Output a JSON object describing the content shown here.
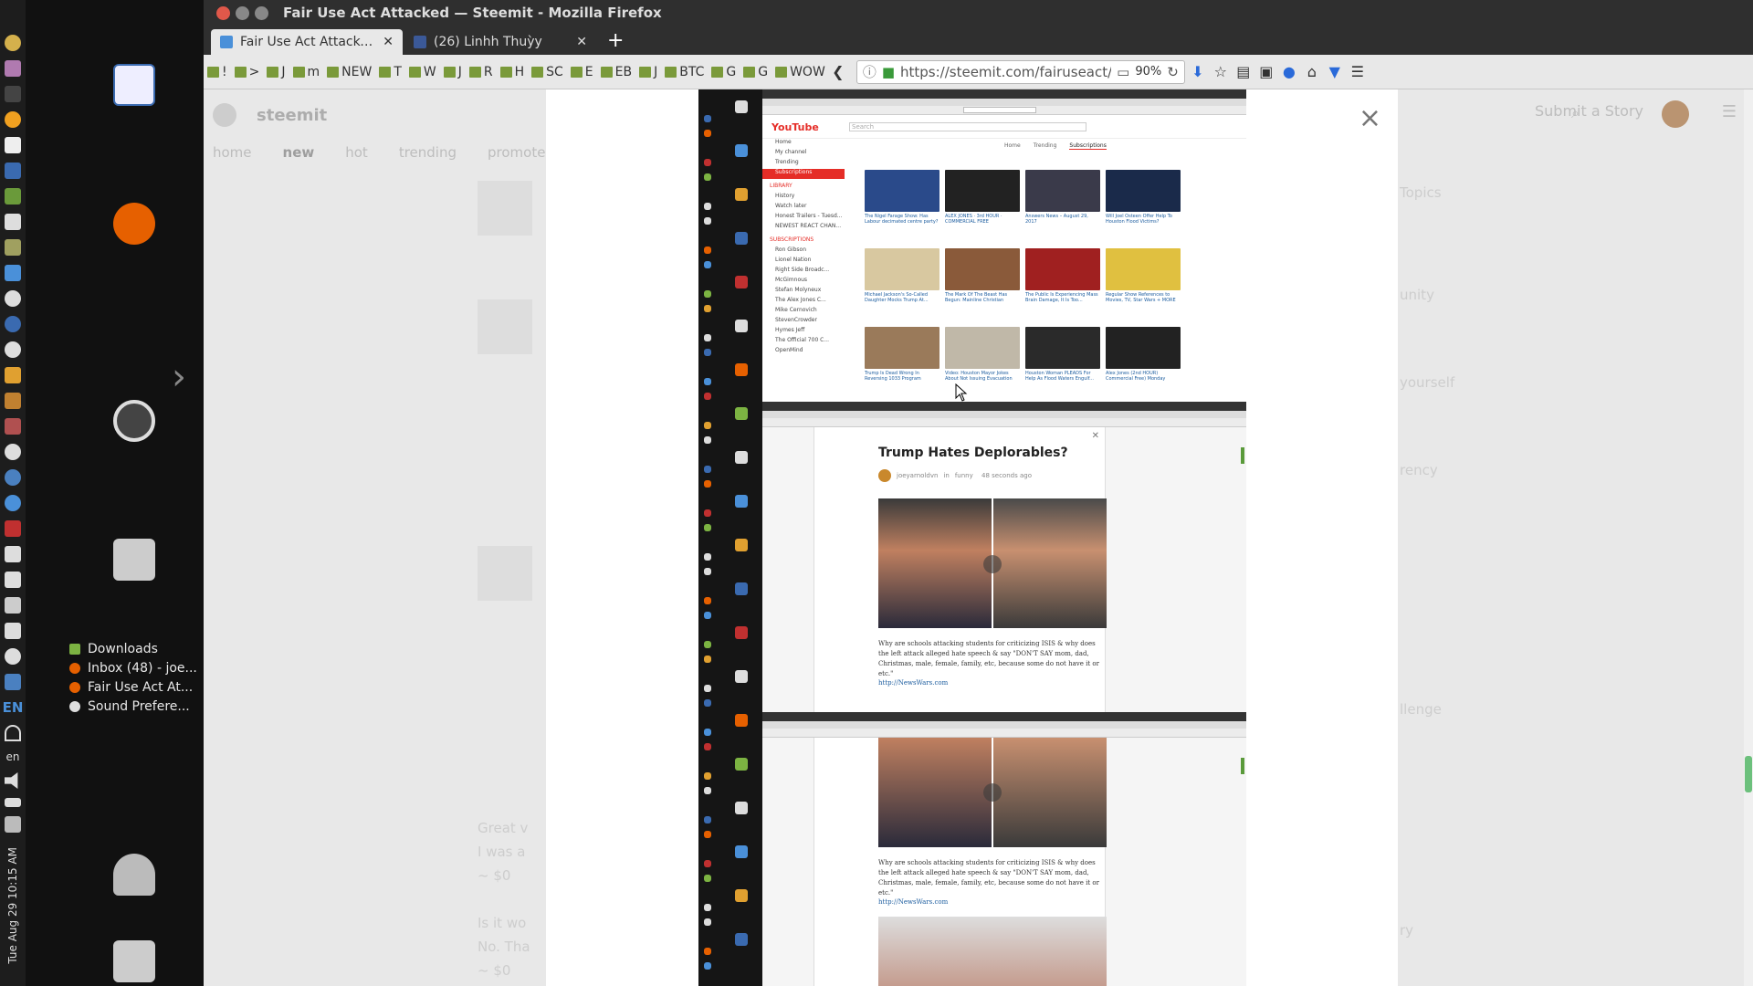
{
  "system": {
    "lang": "EN",
    "lang_small": "en",
    "clock": "Tue Aug 29 10:15 AM"
  },
  "desktop": {
    "files": [
      {
        "label": "Downloads",
        "color": "#7cb342"
      },
      {
        "label": "Inbox (48) - joe...",
        "color": "#e66000"
      },
      {
        "label": "Fair Use Act At...",
        "color": "#e66000"
      },
      {
        "label": "Sound Prefere...",
        "color": "#dddddd"
      }
    ]
  },
  "window": {
    "title": "Fair Use Act Attacked — Steemit - Mozilla Firefox"
  },
  "tabs": [
    {
      "label": "Fair Use Act Attacked -",
      "icon_color": "#4a90d9",
      "active": true
    },
    {
      "label": "(26) Linhh Thuỳy",
      "icon_color": "#3b5998",
      "active": false
    }
  ],
  "bookmarks": [
    "!",
    ">",
    "J",
    "m",
    "NEW",
    "T",
    "W",
    "J",
    "R",
    "H",
    "SC",
    "E",
    "EB",
    "J",
    "BTC",
    "G",
    "G",
    "WOW"
  ],
  "url": "https://steemit.com/fairuseact/@",
  "zoom": "90%",
  "steemit": {
    "logo": "steemit",
    "submit": "Submit a Story",
    "nav": [
      "home",
      "new",
      "hot",
      "trending",
      "promoted"
    ],
    "sidebar": [
      "Topics",
      "unity",
      "yourself",
      "rency",
      "llenge",
      "ry"
    ],
    "feed_titles": [
      {
        "title": "Great v",
        "sub": "I was a"
      },
      {
        "title": "Is it wo",
        "sub": "No. Tha"
      }
    ],
    "payouts": [
      "~ $0",
      "~ $0"
    ]
  },
  "modal": {
    "close": "×"
  },
  "nested": {
    "yt": {
      "logo": "YouTube",
      "search": "Search",
      "tabs": [
        "Home",
        "Trending",
        "Subscriptions"
      ],
      "side_items": [
        "Home",
        "My channel",
        "Trending",
        "Subscriptions"
      ],
      "library_head": "LIBRARY",
      "library_items": [
        "History",
        "Watch later",
        "Honest Trailers - Tuesd...",
        "NEWEST REACT CHAN..."
      ],
      "subs_head": "SUBSCRIPTIONS",
      "subs_items": [
        "Ron Gibson",
        "Lionel Nation",
        "Right Side Broadc...",
        "McGimnous",
        "Stefan Molyneux",
        "The Alex Jones C...",
        "Mike Cernovich",
        "StevenCrowder",
        "Hymes Jeff",
        "The Official 700 C...",
        "OpenMind"
      ],
      "rows": [
        [
          {
            "color": "#2a4a8a",
            "cap": "The Nigel Farage Show: Has Labour decimated centre party?"
          },
          {
            "color": "#222222",
            "cap": "ALEX JONES · 3rd HOUR · COMMERCIAL FREE"
          },
          {
            "color": "#3a3a4a",
            "cap": "Answers News – August 29, 2017"
          },
          {
            "color": "#1a2a4a",
            "cap": "Will Joel Osteen Offer Help To Houston Flood Victims?"
          }
        ],
        [
          {
            "color": "#d8c8a0",
            "cap": "Michael Jackson's So-Called Daughter Mocks Trump At..."
          },
          {
            "color": "#8a5a3a",
            "cap": "The Mark Of The Beast Has Begun: Mainline Christian"
          },
          {
            "color": "#a02020",
            "cap": "The Public Is Experiencing Mass Brain Damage, It Is Too..."
          },
          {
            "color": "#e0c040",
            "cap": "Regular Show References to Movies, TV, Star Wars + MORE"
          }
        ],
        [
          {
            "color": "#9a7a5a",
            "cap": "Trump Is Dead Wrong In Reversing 1033 Program"
          },
          {
            "color": "#c0b8a8",
            "cap": "Video: Houston Mayor Jokes About Not Issuing Evacuation"
          },
          {
            "color": "#2a2a2a",
            "cap": "Houston Woman PLEADS For Help As Flood Waters Engulf..."
          },
          {
            "color": "#222222",
            "cap": "Alex Jones (2nd HOUR) Commercial Free) Monday"
          }
        ]
      ]
    },
    "post": {
      "title": "Trump Hates Deplorables?",
      "author": "joeyarnoldvn",
      "in": "in",
      "category": "funny",
      "ago": "48 seconds ago",
      "body": "Why are schools attacking students for criticizing ISIS & why does the left attack alleged hate speech & say \"DON'T SAY mom, dad, Christmas, male, female, family, etc, because some do not have it or etc.\"",
      "link": "http://NewsWars.com"
    }
  },
  "colors": {
    "steem_green": "#6cc07c",
    "firefox_orange": "#e66000",
    "youtube_red": "#e52d27"
  }
}
